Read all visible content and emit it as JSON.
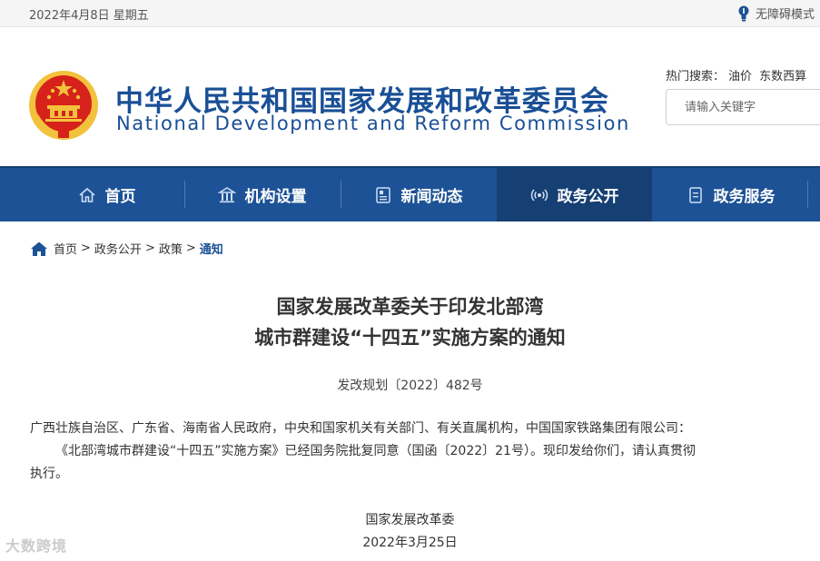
{
  "topbar": {
    "date": "2022年4月8日 星期五",
    "accessibility_label": "无障碍模式"
  },
  "header": {
    "title_cn": "中华人民共和国国家发展和改革委员会",
    "title_en": "National Development and Reform Commission"
  },
  "hot_search": {
    "label": "热门搜索：",
    "items": [
      "油价",
      "东数西算"
    ]
  },
  "search": {
    "placeholder": "请输入关键字"
  },
  "nav": {
    "items": [
      {
        "label": "首页",
        "icon": "home-icon"
      },
      {
        "label": "机构设置",
        "icon": "building-icon"
      },
      {
        "label": "新闻动态",
        "icon": "news-icon"
      },
      {
        "label": "政务公开",
        "icon": "broadcast-icon"
      },
      {
        "label": "政务服务",
        "icon": "document-icon"
      }
    ],
    "active_index": 3
  },
  "breadcrumb": {
    "items": [
      "首页",
      "政务公开",
      "政策",
      "通知"
    ],
    "separator": ">"
  },
  "article": {
    "title_line1": "国家发展改革委关于印发北部湾",
    "title_line2": "城市群建设“十四五”实施方案的通知",
    "doc_number": "发改规划〔2022〕482号",
    "recipients": "广西壮族自治区、广东省、海南省人民政府，中央和国家机关有关部门、有关直属机构，中国国家铁路集团有限公司：",
    "body_line1": "《北部湾城市群建设“十四五”实施方案》已经国务院批复同意（国函〔2022〕21号）。现印发给你们，请认真贯彻",
    "body_line2": "执行。",
    "signer": "国家发展改革委",
    "sign_date": "2022年3月25日"
  },
  "watermark": "大数跨境",
  "colors": {
    "nav_bg": "#1d5296",
    "nav_active": "#163f73",
    "title_blue": "#1a4f96",
    "frame_blue": "#1e88e5",
    "emblem_red": "#d6221b",
    "emblem_gold": "#f3c23c"
  }
}
